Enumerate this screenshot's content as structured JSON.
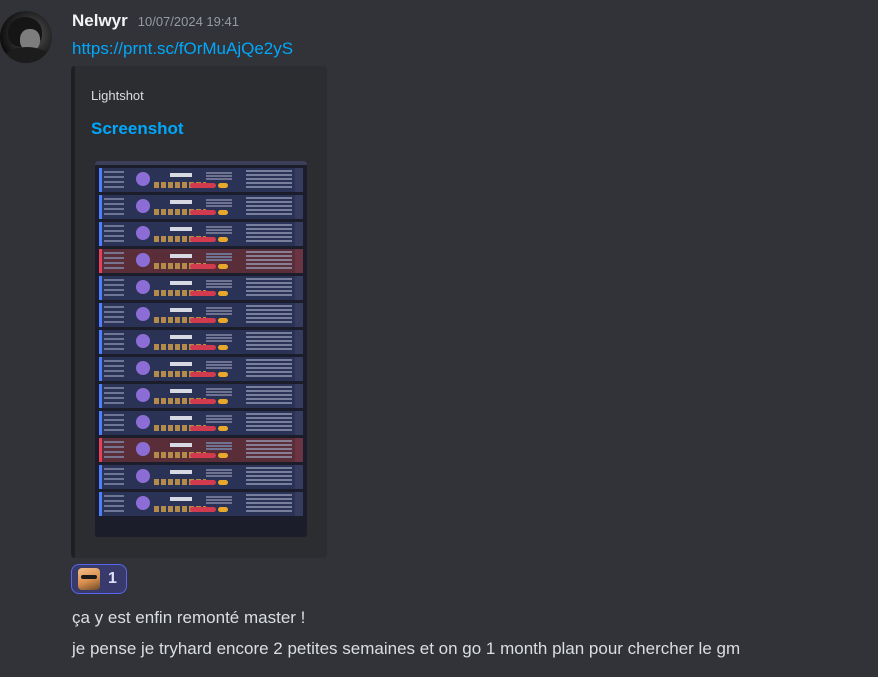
{
  "message": {
    "author": {
      "name": "Nelwyr",
      "avatar": "avatar"
    },
    "timestamp": "10/07/2024 19:41",
    "link": "https://prnt.sc/fOrMuAjQe2yS",
    "embed": {
      "provider": "Lightshot",
      "title": "Screenshot",
      "image_alt_icon": "match-history-screenshot",
      "rows": [
        "win",
        "win",
        "win",
        "loss",
        "win",
        "win",
        "win",
        "win",
        "win",
        "win",
        "loss",
        "win",
        "win"
      ]
    },
    "reaction": {
      "emoji": "cat-sunglasses-emoji",
      "count": "1"
    },
    "content": [
      "ça y est enfin remonté master !",
      "je pense je tryhard encore 2 petites semaines et on go 1 month plan pour chercher le gm"
    ]
  },
  "colors": {
    "background": "#313338",
    "link": "#00a8fc",
    "embed_bg": "#2b2d31",
    "reaction_border": "#5865f2",
    "win": "#4c7eff",
    "loss": "#e84057"
  }
}
